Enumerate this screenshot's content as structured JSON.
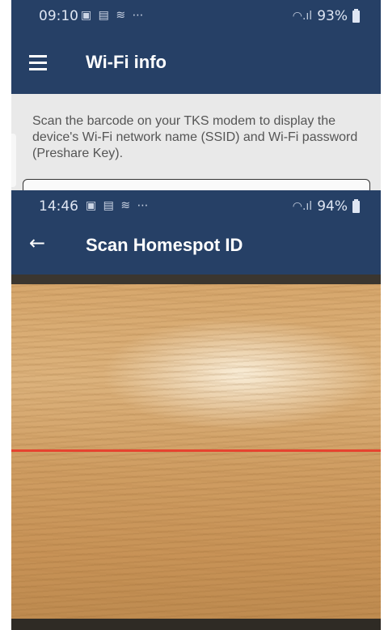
{
  "colors": {
    "app_bar": "#264066",
    "scan_line": "#e6432f",
    "description_text": "#555555"
  },
  "back_screen": {
    "status_bar": {
      "time": "09:10",
      "battery": "93%",
      "icons": [
        "gallery-icon",
        "image-icon",
        "wifi-icon",
        "more-icon"
      ]
    },
    "app_bar": {
      "title": "Wi-Fi info",
      "menu_icon": "hamburger-icon"
    },
    "description": "Scan the barcode on your TKS modem to display the device's Wi-Fi network name (SSID) and Wi-Fi password (Preshare Key)."
  },
  "front_screen": {
    "status_bar": {
      "time": "14:46",
      "battery": "94%",
      "icons": [
        "image-icon",
        "gallery-icon",
        "wifi-icon",
        "more-icon"
      ]
    },
    "app_bar": {
      "title": "Scan Homespot ID",
      "back_icon": "arrow-left-icon"
    }
  },
  "glyphs": {
    "status_icons": "▣ ▤ ≋ ⋯",
    "signal": "◠.ıl",
    "back_arrow": "←"
  }
}
